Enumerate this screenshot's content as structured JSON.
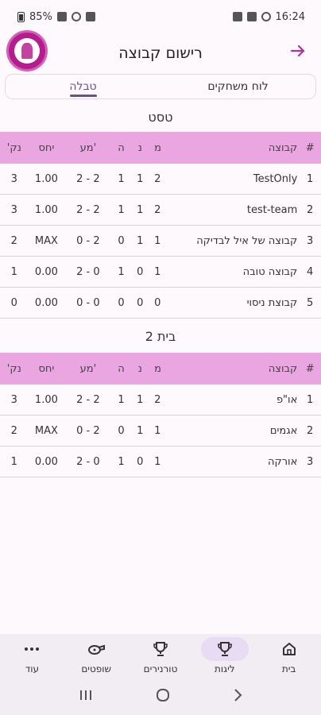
{
  "status_bar": {
    "time": "16:24",
    "battery": "85%"
  },
  "header": {
    "title": "רישום קבוצה"
  },
  "tabs": [
    {
      "label": "לוח משחקים",
      "active": false
    },
    {
      "label": "טבלה",
      "active": true
    }
  ],
  "columns": {
    "rank": "#",
    "team": "קבוצה",
    "games": "מ",
    "wins": "נ",
    "losses": "ה",
    "goals": "מע'",
    "ratio": "יחס",
    "points": "נק'"
  },
  "groups": [
    {
      "name": "טסט",
      "rows": [
        {
          "rank": "1",
          "team": "TestOnly",
          "games": "2",
          "wins": "1",
          "losses": "1",
          "goals": "2 - 2",
          "ratio": "1.00",
          "points": "3"
        },
        {
          "rank": "2",
          "team": "test-team",
          "games": "2",
          "wins": "1",
          "losses": "1",
          "goals": "2 - 2",
          "ratio": "1.00",
          "points": "3"
        },
        {
          "rank": "3",
          "team": "קבוצה של איל לבדיקה",
          "games": "1",
          "wins": "1",
          "losses": "0",
          "goals": "0 - 2",
          "ratio": "MAX",
          "points": "2"
        },
        {
          "rank": "4",
          "team": "קבוצה טובה",
          "games": "1",
          "wins": "0",
          "losses": "1",
          "goals": "2 - 0",
          "ratio": "0.00",
          "points": "1"
        },
        {
          "rank": "5",
          "team": "קבוצת ניסוי",
          "games": "0",
          "wins": "0",
          "losses": "0",
          "goals": "0 - 0",
          "ratio": "0.00",
          "points": "0"
        }
      ]
    },
    {
      "name": "בית 2",
      "rows": [
        {
          "rank": "1",
          "team": "או\"פ",
          "games": "2",
          "wins": "1",
          "losses": "1",
          "goals": "2 - 2",
          "ratio": "1.00",
          "points": "3"
        },
        {
          "rank": "2",
          "team": "אגמים",
          "games": "1",
          "wins": "1",
          "losses": "0",
          "goals": "0 - 2",
          "ratio": "MAX",
          "points": "2"
        },
        {
          "rank": "3",
          "team": "אורקה",
          "games": "1",
          "wins": "0",
          "losses": "1",
          "goals": "2 - 0",
          "ratio": "0.00",
          "points": "1"
        }
      ]
    }
  ],
  "bottom_nav": [
    {
      "label": "עוד",
      "icon": "more-icon"
    },
    {
      "label": "שופטים",
      "icon": "whistle-icon"
    },
    {
      "label": "טורנירים",
      "icon": "trophy-icon"
    },
    {
      "label": "ליגות",
      "icon": "trophy-icon",
      "active": true
    },
    {
      "label": "בית",
      "icon": "home-icon"
    }
  ],
  "colors": {
    "accent": "#b0359b",
    "table_header": "#e9a6e0",
    "active_tab": "#6a4f8c"
  }
}
